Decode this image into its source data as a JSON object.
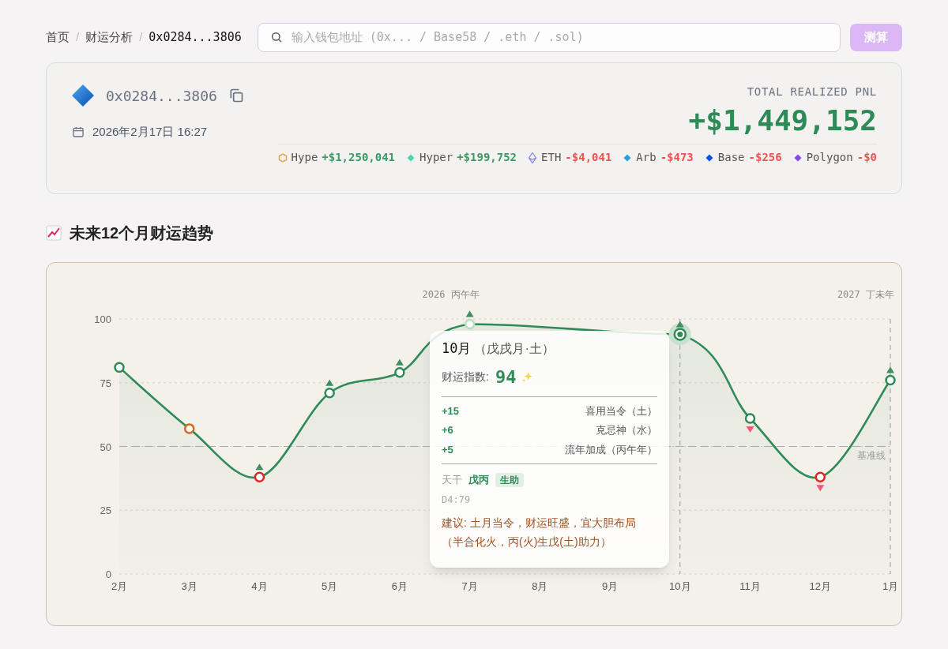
{
  "breadcrumb": [
    {
      "label": "首页",
      "current": false
    },
    {
      "separator": "/",
      "label": "财运分析",
      "current": false
    },
    {
      "separator": "/",
      "label": "0x0284...3806",
      "current": true
    }
  ],
  "search": {
    "placeholder": "输入钱包地址 (0x... / Base58 / .eth / .sol)"
  },
  "submit_button": {
    "label": "测算"
  },
  "wallet": {
    "address": "0x0284...3806",
    "timestamp": "2026年2月17日 16:27",
    "total_label": "TOTAL REALIZED PNL",
    "total": "+$1,449,152",
    "chains": [
      {
        "kind": "hexagon",
        "name": "Hype",
        "pnl": "+$1,250,041",
        "gain": true,
        "color": "#e0a84a"
      },
      {
        "kind": "diamond",
        "name": "Hyper",
        "pnl": "+$199,752",
        "gain": true,
        "color": "#4fd1b5"
      },
      {
        "kind": "eth",
        "name": "ETH",
        "pnl": "-$4,041",
        "gain": false,
        "color": "#7b83e0"
      },
      {
        "kind": "diamond",
        "name": "Arb",
        "pnl": "-$473",
        "gain": false,
        "color": "#2d9cdb"
      },
      {
        "kind": "diamond",
        "name": "Base",
        "pnl": "-$256",
        "gain": false,
        "color": "#0b4ff0"
      },
      {
        "kind": "diamond",
        "name": "Polygon",
        "pnl": "-$0",
        "gain": false,
        "color": "#8247e5"
      }
    ]
  },
  "section_title": "未来12个月财运趋势",
  "trend_chart": {
    "chart_data": {
      "type": "area",
      "categories": [
        "2月",
        "3月",
        "4月",
        "5月",
        "6月",
        "7月",
        "8月",
        "9月",
        "10月",
        "11月",
        "12月",
        "1月"
      ],
      "series": [
        {
          "color": "#2e8b57",
          "marker": "circle",
          "values": [
            81,
            57,
            38,
            71,
            79,
            98,
            null,
            null,
            94,
            61,
            38,
            76
          ]
        }
      ],
      "ylim": [
        0,
        100
      ],
      "yticks": [
        0,
        25,
        50,
        75,
        100
      ],
      "grid": true,
      "ref_lines": [
        {
          "axis": "y",
          "value": 50,
          "label": "基准线"
        },
        {
          "axis": "x",
          "value": "10月"
        }
      ]
    },
    "year_labels": [
      "2026 丙午年",
      "2027 丁未年"
    ],
    "points": [
      {
        "color": "#2e8b57",
        "selected": false
      },
      {
        "color": "#d2691e",
        "selected": false
      },
      {
        "color": "#e02424",
        "up": true,
        "selected": false
      },
      {
        "color": "#2e8b57",
        "up": true,
        "selected": false
      },
      {
        "color": "#2e8b57",
        "up": true,
        "selected": false
      },
      {
        "color": "#b9dcc5",
        "up": true,
        "selected": false
      },
      {
        "color": "#2e8b57",
        "up": true,
        "selected": true
      },
      {
        "color": "#2e8b57",
        "down": true,
        "selected": false
      },
      {
        "color": "#e02424",
        "down": true,
        "selected": false
      },
      {
        "color": "#2e8b57",
        "up": true,
        "selected": false
      }
    ],
    "tooltip": {
      "month": "10月",
      "pillar": "（戊戌月·土）",
      "score_label": "财运指数:",
      "score": "94",
      "factors": [
        {
          "delta": "+15",
          "label": "喜用当令（土）"
        },
        {
          "delta": "+6",
          "label": "克忌神（水）"
        },
        {
          "delta": "+5",
          "label": "流年加成（丙午年）"
        }
      ],
      "stem_label": "天干",
      "stem": "戊丙",
      "relation": "生助",
      "code": "D4:79",
      "advice": "建议: 土月当令，财运旺盛，宜大胆布局（半合化火，丙(火)生戊(土)助力）"
    }
  }
}
